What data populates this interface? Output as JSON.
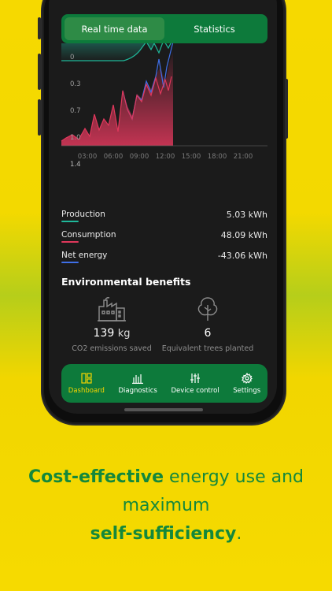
{
  "tabs": {
    "realtime": "Real time data",
    "statistics": "Statistics"
  },
  "chart_data": {
    "type": "area",
    "y_ticks": [
      "0",
      "0.3",
      "0.7",
      "1.0",
      "1.4"
    ],
    "x_ticks": [
      "03:00",
      "06:00",
      "09:00",
      "12:00",
      "15:00",
      "18:00",
      "21:00"
    ],
    "colors": {
      "production": "#1fb89a",
      "consumption": "#e0385c",
      "net": "#3f6fe8"
    }
  },
  "legend": [
    {
      "label": "Production",
      "value": "5.03 kWh",
      "color": "#1fb89a"
    },
    {
      "label": "Consumption",
      "value": "48.09 kWh",
      "color": "#e0385c"
    },
    {
      "label": "Net energy",
      "value": "-43.06 kWh",
      "color": "#3f6fe8"
    }
  ],
  "environment": {
    "title": "Environmental benefits",
    "co2": {
      "value": "139",
      "unit": "kg",
      "caption": "CO2 emissions saved"
    },
    "trees": {
      "value": "6",
      "caption": "Equivalent trees planted"
    }
  },
  "nav": {
    "dashboard": "Dashboard",
    "diagnostics": "Diagnostics",
    "device_control": "Device control",
    "settings": "Settings"
  },
  "tagline": {
    "part1": "Cost-effective",
    "part2": " energy use and maximum",
    "part3": "self-sufficiency",
    "part4": "."
  }
}
